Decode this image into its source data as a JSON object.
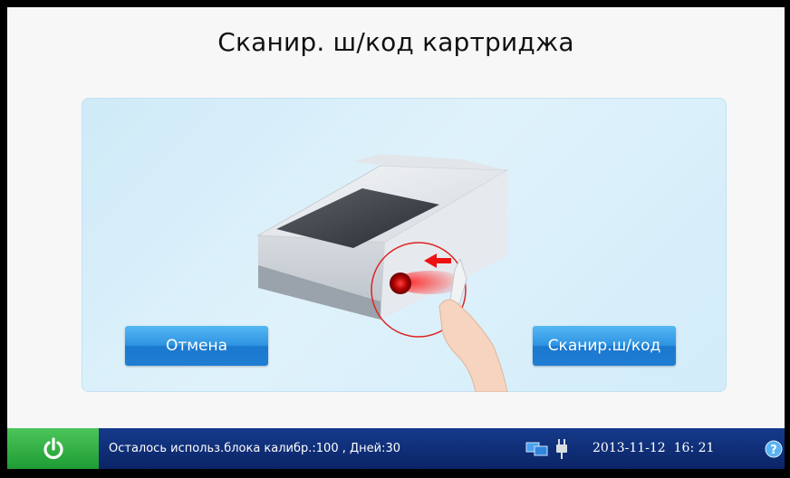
{
  "header": {
    "title": "Сканир. ш/код картриджа"
  },
  "buttons": {
    "cancel": "Отмена",
    "scan": "Сканир.ш/код"
  },
  "statusbar": {
    "calibration_text": "Осталось использ.блока калибр.:100 , Дней:30",
    "date": "2013-11-12",
    "time": "16: 21",
    "icons": [
      "power-icon",
      "network-icon",
      "power-plug-icon",
      "help-icon"
    ]
  },
  "colors": {
    "statusbar": "#0b2466",
    "power_button": "#2db043",
    "button_blue": "#2f94e2",
    "panel_bg": "#d6eefa",
    "laser_red": "#e02020"
  }
}
